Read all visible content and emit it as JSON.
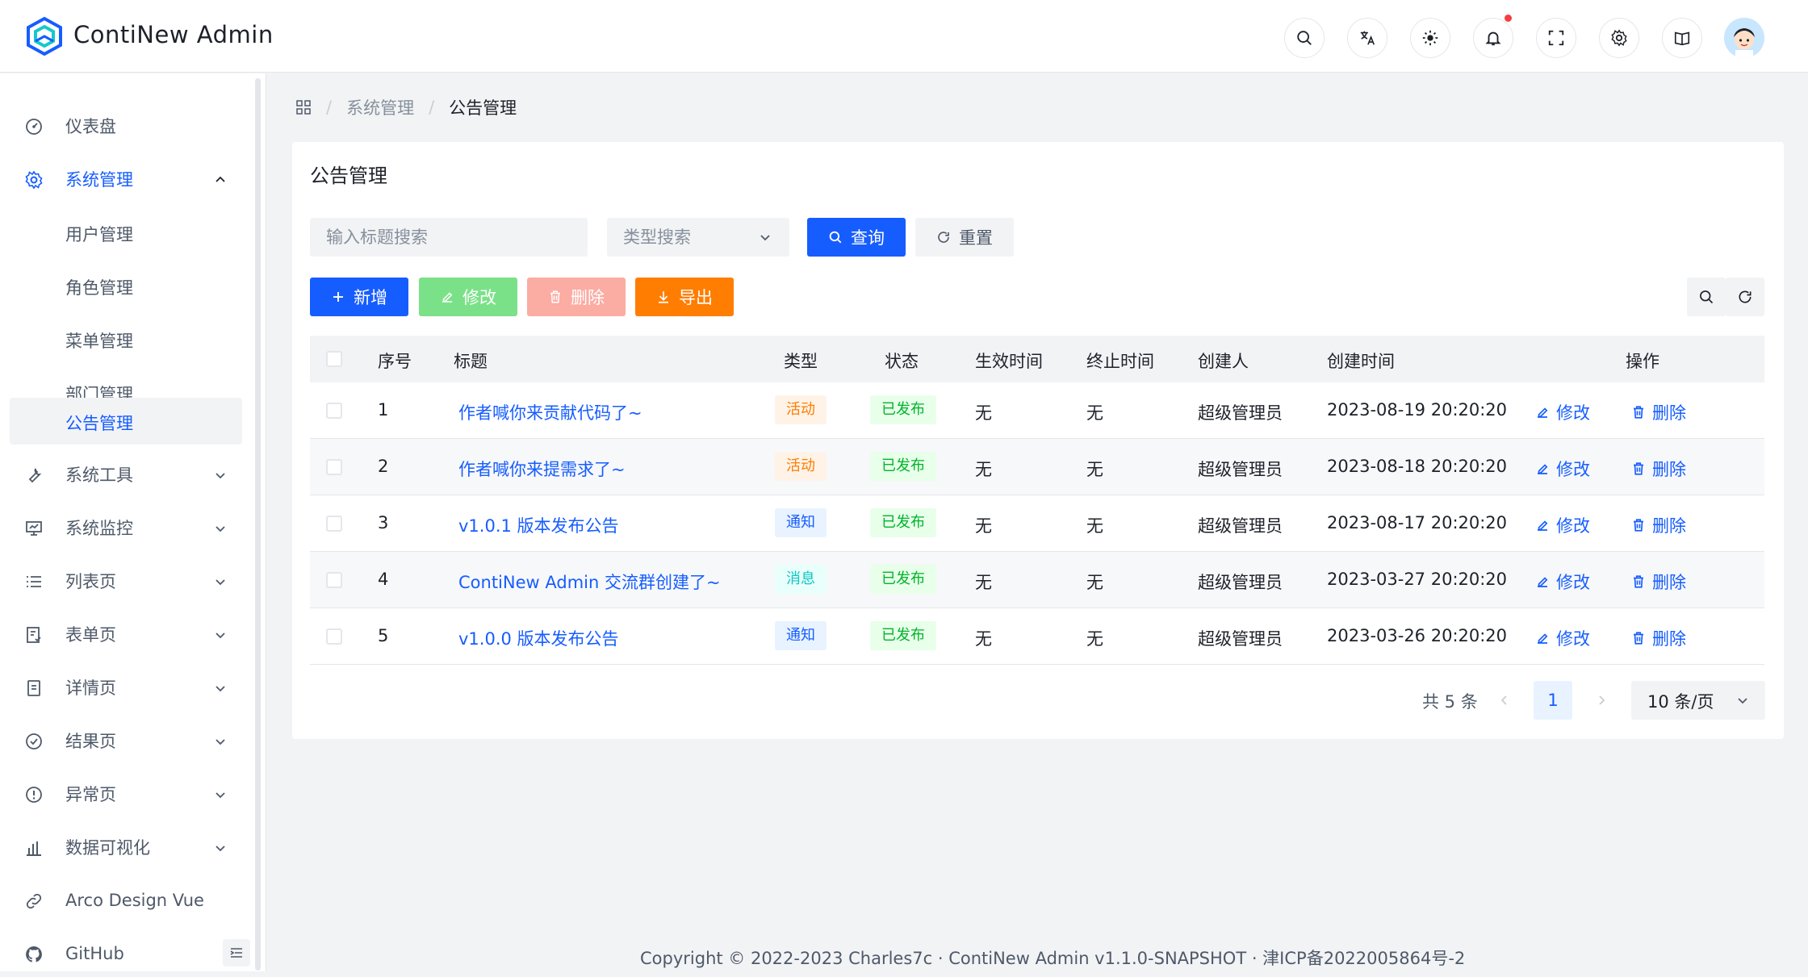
{
  "app": {
    "title": "ContiNew Admin"
  },
  "header_icons": [
    "search-icon",
    "translate-icon",
    "theme-sun-icon",
    "bell-icon",
    "fullscreen-icon",
    "settings-icon",
    "docs-book-icon"
  ],
  "sidebar": {
    "items": [
      {
        "label": "仪表盘",
        "icon": "dashboard-icon"
      },
      {
        "label": "系统管理",
        "icon": "gear-icon",
        "open": true
      },
      {
        "label": "系统工具",
        "icon": "wrench-icon"
      },
      {
        "label": "系统监控",
        "icon": "monitor-icon"
      },
      {
        "label": "列表页",
        "icon": "list-icon"
      },
      {
        "label": "表单页",
        "icon": "form-icon"
      },
      {
        "label": "详情页",
        "icon": "file-icon"
      },
      {
        "label": "结果页",
        "icon": "check-circle-icon"
      },
      {
        "label": "异常页",
        "icon": "exclamation-icon"
      },
      {
        "label": "数据可视化",
        "icon": "bar-chart-icon"
      },
      {
        "label": "Arco Design Vue",
        "icon": "link-icon"
      },
      {
        "label": "GitHub",
        "icon": "github-icon"
      }
    ],
    "sub_items": [
      "用户管理",
      "角色管理",
      "菜单管理",
      "部门管理",
      "公告管理"
    ]
  },
  "breadcrumb": {
    "level1": "系统管理",
    "current": "公告管理"
  },
  "card": {
    "title": "公告管理",
    "search": {
      "title_placeholder": "输入标题搜索",
      "type_placeholder": "类型搜索",
      "query_label": "查询",
      "reset_label": "重置"
    },
    "actions": {
      "add": "新增",
      "edit": "修改",
      "delete": "删除",
      "export": "导出"
    }
  },
  "table": {
    "headers": {
      "index": "序号",
      "title": "标题",
      "type": "类型",
      "status": "状态",
      "effective": "生效时间",
      "end": "终止时间",
      "creator": "创建人",
      "created": "创建时间",
      "ops": "操作"
    },
    "rows": [
      {
        "index": "1",
        "title": "作者喊你来贡献代码了~",
        "type": "活动",
        "status": "已发布",
        "effective": "无",
        "end": "无",
        "creator": "超级管理员",
        "created": "2023-08-19 20:20:20",
        "edit": "修改",
        "delete": "删除"
      },
      {
        "index": "2",
        "title": "作者喊你来提需求了~",
        "type": "活动",
        "status": "已发布",
        "effective": "无",
        "end": "无",
        "creator": "超级管理员",
        "created": "2023-08-18 20:20:20",
        "edit": "修改",
        "delete": "删除"
      },
      {
        "index": "3",
        "title": "v1.0.1 版本发布公告",
        "type": "通知",
        "status": "已发布",
        "effective": "无",
        "end": "无",
        "creator": "超级管理员",
        "created": "2023-08-17 20:20:20",
        "edit": "修改",
        "delete": "删除"
      },
      {
        "index": "4",
        "title": "ContiNew Admin 交流群创建了~",
        "type": "消息",
        "status": "已发布",
        "effective": "无",
        "end": "无",
        "creator": "超级管理员",
        "created": "2023-03-27 20:20:20",
        "edit": "修改",
        "delete": "删除"
      },
      {
        "index": "5",
        "title": "v1.0.0 版本发布公告",
        "type": "通知",
        "status": "已发布",
        "effective": "无",
        "end": "无",
        "creator": "超级管理员",
        "created": "2023-03-26 20:20:20",
        "edit": "修改",
        "delete": "删除"
      }
    ]
  },
  "pagination": {
    "total": "共 5 条",
    "current_page": "1",
    "page_size": "10 条/页"
  },
  "footer": "Copyright © 2022-2023 Charles7c · ContiNew Admin  v1.1.0-SNAPSHOT · 津ICP备2022005864号-2",
  "colors": {
    "primary": "#165dff",
    "success": "#7be188",
    "danger": "#fbaca3",
    "warning": "#ff7d00"
  }
}
